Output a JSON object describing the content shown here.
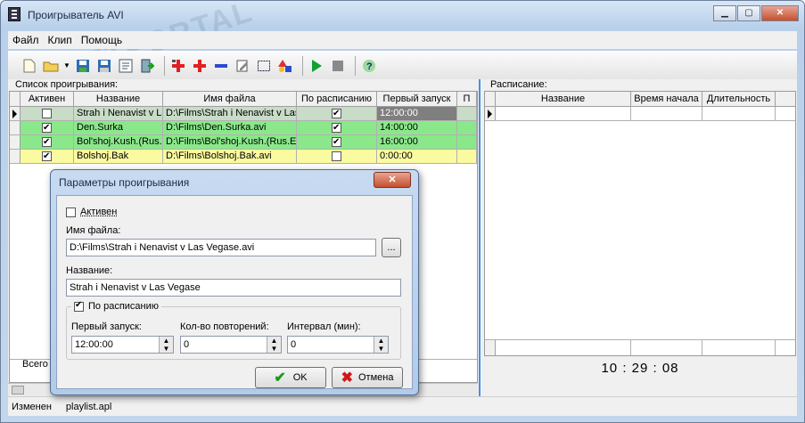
{
  "window": {
    "title": "Проигрыватель AVI",
    "min": "▁",
    "max": "▢",
    "close": "✕"
  },
  "menu": [
    "Файл",
    "Клип",
    "Помощь"
  ],
  "toolbar_icons": [
    "new-file-icon",
    "open-folder-icon",
    "dropdown-arrow-icon",
    "save-icon",
    "save-as-icon",
    "properties-icon",
    "exit-icon",
    "add-clip-icon",
    "add-icon",
    "remove-icon",
    "edit-icon",
    "select-icon",
    "shapes-icon",
    "play-icon",
    "stop-icon",
    "help-icon"
  ],
  "watermark": "SOFTPORTAL",
  "playlist": {
    "label": "Список проигрывания:",
    "columns": [
      "Активен",
      "Название",
      "Имя файла",
      "По расписанию",
      "Первый запуск",
      "П"
    ],
    "rows": [
      {
        "active": false,
        "name": "Strah i Nenavist v La",
        "file": "D:\\Films\\Strah i Nenavist v Las",
        "scheduled": true,
        "first": "12:00:00",
        "color": "#c8dcc8",
        "current": true
      },
      {
        "active": true,
        "name": "Den.Surka",
        "file": "D:\\Films\\Den.Surka.avi",
        "scheduled": true,
        "first": "14:00:00",
        "color": "#8ae88a",
        "current": false
      },
      {
        "active": true,
        "name": "Bol'shoj.Kush.(Rus.E",
        "file": "D:\\Films\\Bol'shoj.Kush.(Rus.En",
        "scheduled": true,
        "first": "16:00:00",
        "color": "#8ae88a",
        "current": false
      },
      {
        "active": true,
        "name": "Bolshoj.Bak",
        "file": "D:\\Films\\Bolshoj.Bak.avi",
        "scheduled": false,
        "first": "0:00:00",
        "color": "#fafaa0",
        "current": false
      }
    ],
    "footer": "Всего"
  },
  "schedule": {
    "label": "Расписание:",
    "columns": [
      "Название",
      "Время начала",
      "Длительность"
    ],
    "clock": "10 : 29 : 08"
  },
  "status": {
    "state": "Изменен",
    "file": "playlist.apl"
  },
  "dialog": {
    "title": "Параметры проигрывания",
    "close": "✕",
    "active_label": "Активен",
    "active_checked": false,
    "file_label": "Имя файла:",
    "file_value": "D:\\Films\\Strah i Nenavist v Las Vegase.avi",
    "browse_label": "...",
    "name_label": "Название:",
    "name_value": "Strah i Nenavist v Las Vegase",
    "sched_label": "По расписанию",
    "sched_checked": true,
    "first_label": "Первый запуск:",
    "first_value": "12:00:00",
    "repeat_label": "Кол-во повторений:",
    "repeat_value": "0",
    "interval_label": "Интервал (мин):",
    "interval_value": "0",
    "ok_label": "OK",
    "cancel_label": "Отмена"
  }
}
